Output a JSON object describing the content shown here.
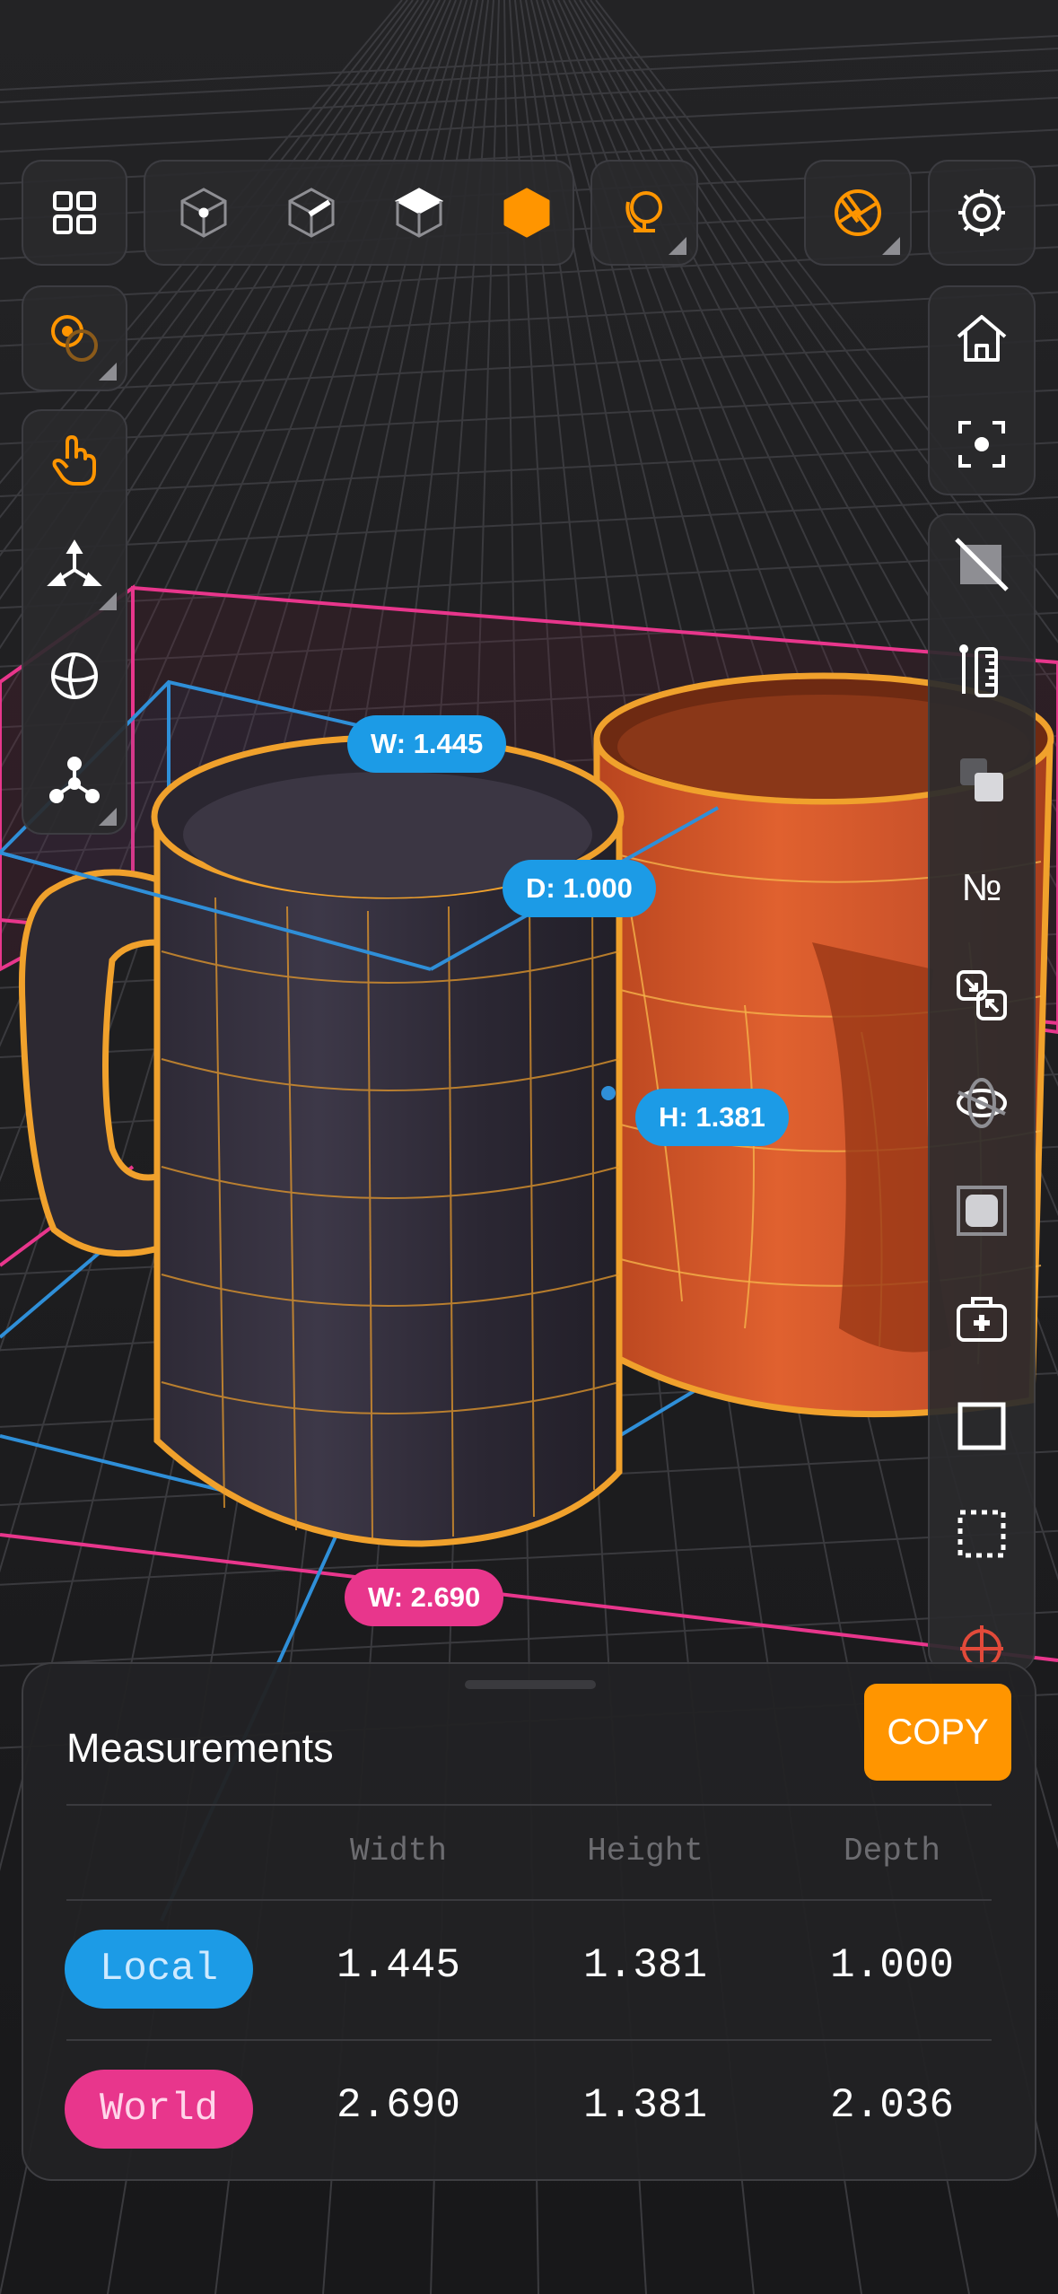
{
  "dimension_labels": {
    "local_width": "W: 1.445",
    "local_depth": "D: 1.000",
    "local_height": "H: 1.381",
    "world_width": "W: 2.690"
  },
  "top_toolbar": [
    "grid-icon",
    "vertex-mode-icon",
    "edge-mode-icon",
    "face-mode-icon",
    "object-mode-icon",
    "orbit-pivot-icon",
    "camera-lens-icon",
    "settings-icon"
  ],
  "left_toolbar": [
    "pivot-point-icon",
    "touch-select-icon",
    "move-gizmo-icon",
    "rotate-gizmo-icon",
    "transform-gizmo-icon"
  ],
  "right_toolbar": [
    "home-icon",
    "focus-frame-icon",
    "hide-overlay-icon",
    "measure-ruler-icon",
    "duplicate-icon",
    "number-icon",
    "scale-arrows-icon",
    "view-orbit-icon",
    "material-icon",
    "toolbox-icon",
    "box-select-icon",
    "dotted-select-icon",
    "snap-target-icon"
  ],
  "measurements": {
    "title": "Measurements",
    "copy_label": "COPY",
    "columns": [
      "Width",
      "Height",
      "Depth"
    ],
    "rows": [
      {
        "label": "Local",
        "values": [
          "1.445",
          "1.381",
          "1.000"
        ],
        "color": "#1c9be6"
      },
      {
        "label": "World",
        "values": [
          "2.690",
          "1.381",
          "2.036"
        ],
        "color": "#e8368c"
      }
    ]
  },
  "colors": {
    "accent_orange": "#ff9500",
    "local_blue": "#1c9be6",
    "world_pink": "#e8368c",
    "selection_outline": "#f0a12c"
  }
}
